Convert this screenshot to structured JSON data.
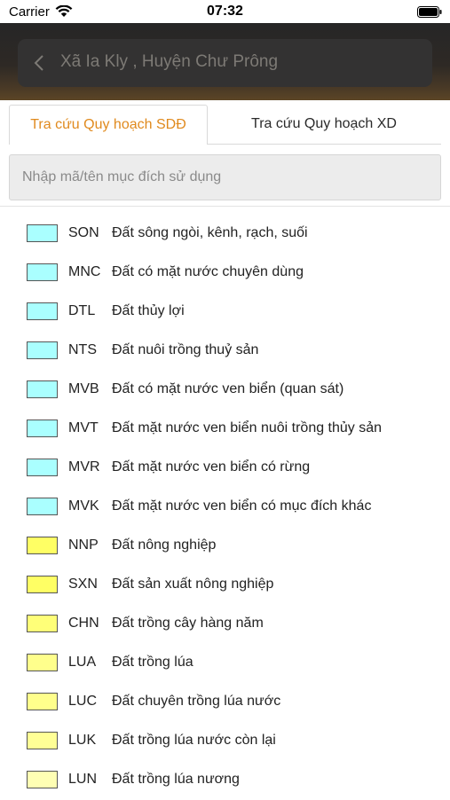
{
  "status_bar": {
    "carrier": "Carrier",
    "time": "07:32",
    "wifi_icon": "wifi-icon",
    "battery_icon": "battery-icon"
  },
  "header": {
    "title": "Xã Ia Kly , Huyện Chư Prông",
    "back_icon": "chevron-left-icon"
  },
  "tabs": [
    {
      "label": "Tra cứu Quy hoạch SDĐ",
      "active": true
    },
    {
      "label": "Tra cứu Quy hoạch XD",
      "active": false
    }
  ],
  "search": {
    "placeholder": "Nhập mã/tên mục đích sử dụng",
    "value": ""
  },
  "colors": {
    "active_tab": "#e08a1e",
    "water": "#aaffff",
    "agri": "#ffff64",
    "rice": "#ffff9e"
  },
  "legend": [
    {
      "code": "SON",
      "label": "Đất sông ngòi, kênh, rạch, suối",
      "color": "#aaffff"
    },
    {
      "code": "MNC",
      "label": "Đất có mặt nước chuyên dùng",
      "color": "#aaffff"
    },
    {
      "code": "DTL",
      "label": "Đất thủy lợi",
      "color": "#aaffff"
    },
    {
      "code": "NTS",
      "label": "Đất nuôi trồng thuỷ sản",
      "color": "#aaffff"
    },
    {
      "code": "MVB",
      "label": "Đất có mặt nước ven biển (quan sát)",
      "color": "#aaffff"
    },
    {
      "code": "MVT",
      "label": "Đất mặt nước ven biển nuôi trồng thủy sản",
      "color": "#aaffff"
    },
    {
      "code": "MVR",
      "label": "Đất mặt nước ven biển có rừng",
      "color": "#aaffff"
    },
    {
      "code": "MVK",
      "label": "Đất mặt nước ven biển có mục đích khác",
      "color": "#aaffff"
    },
    {
      "code": "NNP",
      "label": "Đất nông nghiệp",
      "color": "#ffff64"
    },
    {
      "code": "SXN",
      "label": "Đất sản xuất nông nghiệp",
      "color": "#ffff64"
    },
    {
      "code": "CHN",
      "label": "Đất trồng cây hàng năm",
      "color": "#ffff78"
    },
    {
      "code": "LUA",
      "label": "Đất trồng lúa",
      "color": "#ffff8c"
    },
    {
      "code": "LUC",
      "label": "Đất chuyên trồng lúa nước",
      "color": "#ffff8c"
    },
    {
      "code": "LUK",
      "label": "Đất trồng lúa nước còn lại",
      "color": "#ffff96"
    },
    {
      "code": "LUN",
      "label": "Đất trồng lúa nương",
      "color": "#ffffb4"
    }
  ]
}
